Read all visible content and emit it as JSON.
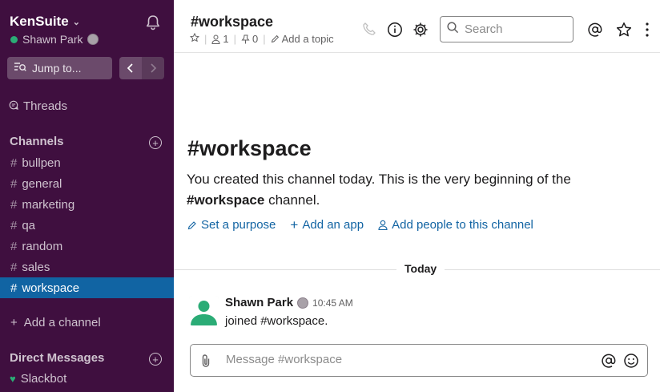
{
  "workspace": {
    "name": "KenSuite",
    "user": "Shawn Park"
  },
  "sidebar": {
    "jump_label": "Jump to...",
    "threads_label": "Threads",
    "channels_heading": "Channels",
    "channels": [
      "bullpen",
      "general",
      "marketing",
      "qa",
      "random",
      "sales",
      "workspace"
    ],
    "active_channel": "workspace",
    "add_channel_label": "Add a channel",
    "dm_heading": "Direct Messages",
    "dms": [
      "Slackbot"
    ]
  },
  "header": {
    "channel_title": "#workspace",
    "members_count": "1",
    "pins_count": "0",
    "add_topic_label": "Add a topic",
    "search_placeholder": "Search"
  },
  "intro": {
    "title": "#workspace",
    "text_prefix": "You created this channel today. This is the very beginning of the ",
    "text_channel": "#workspace",
    "text_suffix": " channel.",
    "set_purpose": "Set a purpose",
    "add_app": "Add an app",
    "add_people": "Add people to this channel"
  },
  "divider_label": "Today",
  "message": {
    "author": "Shawn Park",
    "time": "10:45 AM",
    "text": "joined #workspace."
  },
  "composer": {
    "placeholder": "Message #workspace"
  },
  "colors": {
    "sidebar_bg": "#3f0f3f",
    "active_channel_bg": "#1164a3",
    "link": "#1264a3",
    "presence_green": "#2bac76"
  }
}
